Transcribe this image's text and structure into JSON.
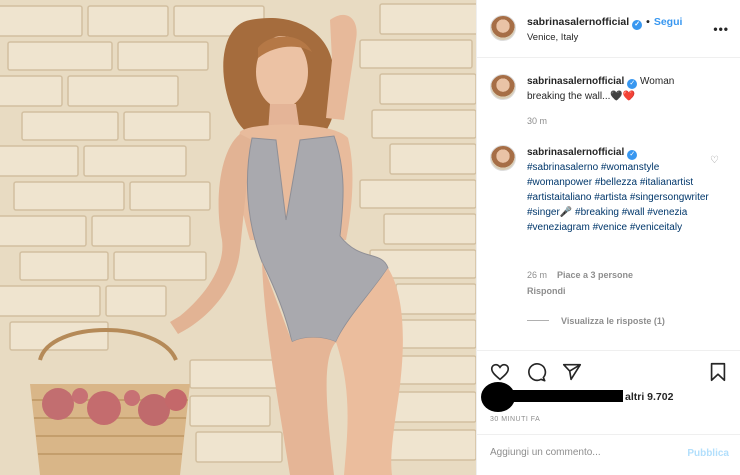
{
  "post": {
    "username": "sabrinasalernofficial",
    "follow_label": "Segui",
    "location": "Venice, Italy",
    "more_label": "•••"
  },
  "caption": {
    "username": "sabrinasalernofficial",
    "text": "Woman breaking the wall...🖤❤️",
    "time": "30 m"
  },
  "comment": {
    "username": "sabrinasalernofficial",
    "text": "#sabrinasalerno #womanstyle #womanpower #bellezza #italianartist #artistaitaliano #artista #singersongwriter #singer🎤 #breaking #wall #venezia #veneziagram #venice #veniceitaly",
    "time": "26 m",
    "likes": "Piace a 3 persone",
    "reply_label": "Rispondi",
    "view_replies": "Visualizza le risposte (1)"
  },
  "likes": {
    "others": "altri 9.702"
  },
  "timestamp": "30 MINUTI FA",
  "composer": {
    "placeholder": "Aggiungi un commento...",
    "publish_label": "Pubblica"
  },
  "icons": [
    "like-icon",
    "comment-icon",
    "share-icon",
    "save-icon",
    "verified-icon",
    "more-icon",
    "heart-small-icon"
  ],
  "colors": {
    "link_blue": "#3897f0",
    "hashtag": "#00376b",
    "muted": "#8e8e8e",
    "publish_disabled": "#b2dffc"
  }
}
